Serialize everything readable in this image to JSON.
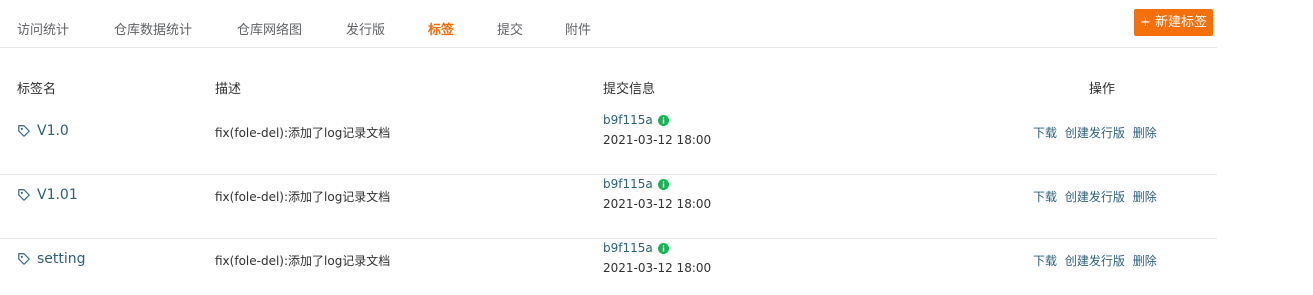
{
  "tabs": [
    {
      "label": "访问统计",
      "active": false
    },
    {
      "label": "仓库数据统计",
      "active": false
    },
    {
      "label": "仓库网络图",
      "active": false
    },
    {
      "label": "发行版",
      "active": false
    },
    {
      "label": "标签",
      "active": true
    },
    {
      "label": "提交",
      "active": false
    },
    {
      "label": "附件",
      "active": false
    }
  ],
  "new_tag_button": "+ 新建标签",
  "table": {
    "headers": {
      "name": "标签名",
      "description": "描述",
      "commit": "提交信息",
      "actions": "操作"
    },
    "rows": [
      {
        "name": "V1.0",
        "description": "fix(fole-del):添加了log记录文档",
        "sha": "b9f115a",
        "date": "2021-03-12 18:00",
        "download": "下载",
        "create_release": "创建发行版",
        "delete": "删除"
      },
      {
        "name": "V1.01",
        "description": "fix(fole-del):添加了log记录文档",
        "sha": "b9f115a",
        "date": "2021-03-12 18:00",
        "download": "下载",
        "create_release": "创建发行版",
        "delete": "删除"
      },
      {
        "name": "setting",
        "description": "fix(fole-del):添加了log记录文档",
        "sha": "b9f115a",
        "date": "2021-03-12 18:00",
        "download": "下载",
        "create_release": "创建发行版",
        "delete": "删除"
      }
    ]
  },
  "colors": {
    "accent": "#f5700a",
    "link": "#2e6179",
    "info_icon": "#18b357",
    "divider": "#e4e7ed"
  },
  "icons": {
    "tag": "tag-icon",
    "info": "info-icon"
  }
}
